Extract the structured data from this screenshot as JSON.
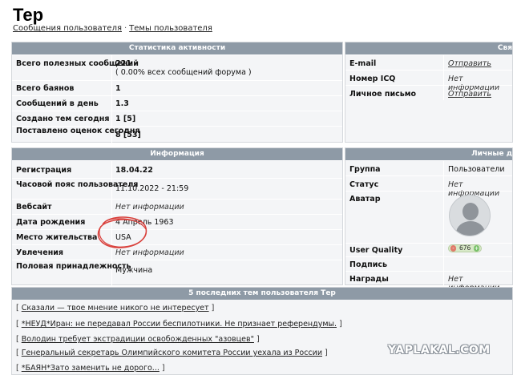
{
  "page": {
    "title": "Тер",
    "links": [
      "Сообщения пользователя",
      "Темы пользователя"
    ],
    "separator": "·"
  },
  "stats": {
    "header": "Статистика активности",
    "rows": [
      {
        "label": "Всего полезных сообщений",
        "value": "221",
        "value2": "( 0.00% всех сообщений форума )"
      },
      {
        "label": "Всего баянов",
        "value": "1"
      },
      {
        "label": "Сообщений в день",
        "value": "1.3"
      },
      {
        "label": "Создано тем сегодня",
        "value": "1 [5]"
      },
      {
        "label": "Поставлено оценок сегодня",
        "value": "8 [53]"
      }
    ]
  },
  "contact": {
    "header": "Свя",
    "rows": [
      {
        "label": "E-mail",
        "value": "Отправить"
      },
      {
        "label": "Номер ICQ",
        "value": "Нет информации"
      },
      {
        "label": "Личное письмо",
        "value": "Отправить"
      }
    ]
  },
  "info": {
    "header": "Информация",
    "rows": [
      {
        "label": "Регистрация",
        "value": "18.04.22"
      },
      {
        "label": "Часовой пояс пользователя",
        "value": "11.10.2022 - 21:59"
      },
      {
        "label": "Вебсайт",
        "value": "Нет информации"
      },
      {
        "label": "Дата рождения",
        "value": "4 Апрель 1963"
      },
      {
        "label": "Место жительства",
        "value": "USA"
      },
      {
        "label": "Увлечения",
        "value": "Нет информации"
      },
      {
        "label": "Половая принадлежность",
        "value": "Мужчина"
      }
    ]
  },
  "personal": {
    "header": "Личные д",
    "rows": [
      {
        "label": "Группа",
        "value": "Пользователи"
      },
      {
        "label": "Статус",
        "value": "Нет информации"
      },
      {
        "label": "Аватар",
        "value": ""
      },
      {
        "label": "User Quality",
        "value": ""
      },
      {
        "label": "Подпись",
        "value": ""
      },
      {
        "label": "Награды",
        "value": "Нет информации"
      }
    ],
    "quality": {
      "minus": "-",
      "score": "676",
      "plus": "+",
      "fraction": 0.7
    }
  },
  "topics": {
    "header": "5 последних тем пользователя Тер",
    "items": [
      "Сказали — твое мнение никого не интересует",
      "*НЕУД*Иран: не передавал России беспилотники. Не признает референдумы.",
      "Володин требует экстрадиции освобожденных \"азовцев\"",
      "Генеральный секретарь Олимпийского комитета России уехала из России",
      "*БАЯН*Зато заменить не дорого..."
    ]
  },
  "watermark": "YAPLAKAL.COM",
  "colors": {
    "header_bg": "#8e9aa6",
    "panel_bg": "#f4f5f7",
    "circle": "#d9413c"
  }
}
